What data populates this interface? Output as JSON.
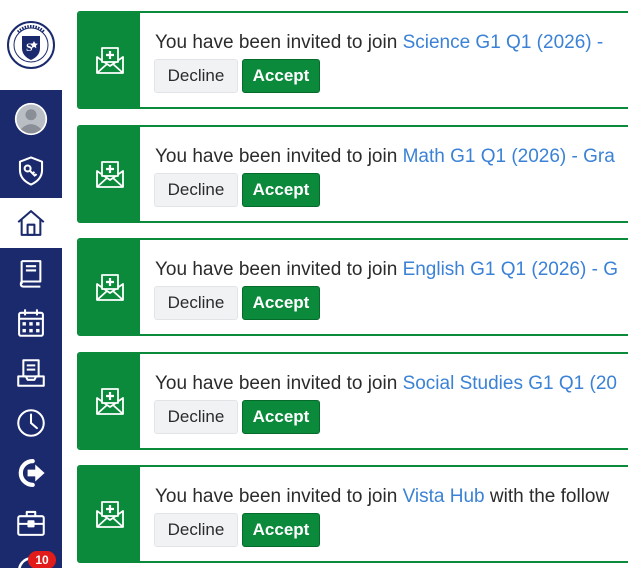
{
  "logo": {
    "name": "scholarsvista-logo"
  },
  "sidebar": {
    "items": [
      {
        "name": "profile-avatar",
        "icon": "user-avatar-icon",
        "active": false
      },
      {
        "name": "security",
        "icon": "shield-key-icon",
        "active": false
      },
      {
        "name": "home",
        "icon": "home-icon",
        "active": true
      },
      {
        "name": "courses",
        "icon": "book-icon",
        "active": false
      },
      {
        "name": "calendar",
        "icon": "calendar-icon",
        "active": false
      },
      {
        "name": "reports",
        "icon": "document-tray-icon",
        "active": false
      },
      {
        "name": "history",
        "icon": "clock-icon",
        "active": false
      },
      {
        "name": "logout",
        "icon": "sign-out-icon",
        "active": false
      },
      {
        "name": "portfolio",
        "icon": "briefcase-icon",
        "active": false
      },
      {
        "name": "notifications",
        "icon": "refresh-icon",
        "active": false,
        "badge": "10"
      }
    ],
    "badge_color": "#e21b1b",
    "background": "#1a2a6c"
  },
  "invitations": [
    {
      "prefix": "You have been invited to join ",
      "course": "Science G1 Q1 (2026) -",
      "suffix": "",
      "decline": "Decline",
      "accept": "Accept"
    },
    {
      "prefix": "You have been invited to join ",
      "course": "Math G1 Q1 (2026) - Gra",
      "suffix": "",
      "decline": "Decline",
      "accept": "Accept"
    },
    {
      "prefix": "You have been invited to join ",
      "course": "English G1 Q1 (2026) - G",
      "suffix": "",
      "decline": "Decline",
      "accept": "Accept"
    },
    {
      "prefix": "You have been invited to join ",
      "course": "Social Studies G1 Q1 (20",
      "suffix": "",
      "decline": "Decline",
      "accept": "Accept"
    },
    {
      "prefix": "You have been invited to join ",
      "course": "Vista Hub",
      "suffix": " with the follow",
      "decline": "Decline",
      "accept": "Accept"
    }
  ],
  "colors": {
    "accent_green": "#0a8a3a",
    "link_blue": "#3b82d6"
  }
}
